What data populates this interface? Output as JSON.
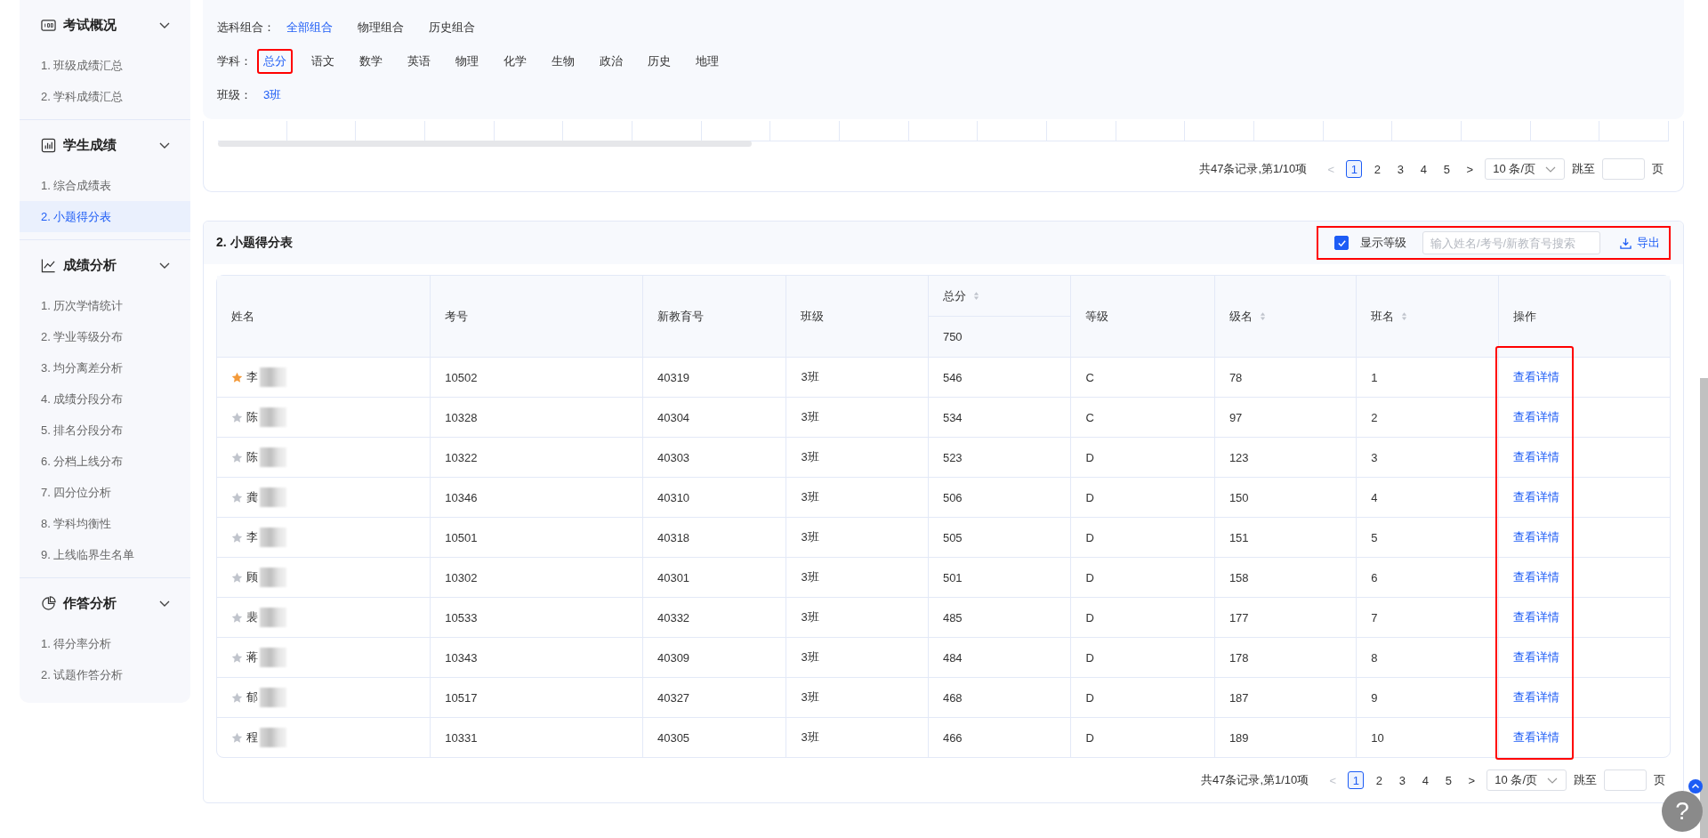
{
  "sidebar": {
    "sections": [
      {
        "title": "考试概况",
        "kind": "score",
        "expanded": true,
        "items": [
          {
            "label": "1. 班级成绩汇总",
            "selected": false
          },
          {
            "label": "2. 学科成绩汇总",
            "selected": false
          }
        ]
      },
      {
        "title": "学生成绩",
        "kind": "bars",
        "expanded": true,
        "items": [
          {
            "label": "1. 综合成绩表",
            "selected": false
          },
          {
            "label": "2. 小题得分表",
            "selected": true
          }
        ]
      },
      {
        "title": "成绩分析",
        "kind": "line",
        "expanded": true,
        "items": [
          {
            "label": "1. 历次学情统计",
            "selected": false
          },
          {
            "label": "2. 学业等级分布",
            "selected": false
          },
          {
            "label": "3. 均分离差分析",
            "selected": false
          },
          {
            "label": "4. 成绩分段分布",
            "selected": false
          },
          {
            "label": "5. 排名分段分布",
            "selected": false
          },
          {
            "label": "6. 分档上线分布",
            "selected": false
          },
          {
            "label": "7. 四分位分析",
            "selected": false
          },
          {
            "label": "8. 学科均衡性",
            "selected": false
          },
          {
            "label": "9. 上线临界生名单",
            "selected": false
          }
        ]
      },
      {
        "title": "作答分析",
        "kind": "pie",
        "expanded": true,
        "items": [
          {
            "label": "1. 得分率分析",
            "selected": false
          },
          {
            "label": "2. 试题作答分析",
            "selected": false
          }
        ]
      }
    ]
  },
  "filters": [
    {
      "label": "选科组合：",
      "options": [
        {
          "label": "全部组合",
          "selected": true,
          "highlighted": false
        },
        {
          "label": "物理组合",
          "selected": false,
          "highlighted": false
        },
        {
          "label": "历史组合",
          "selected": false,
          "highlighted": false
        }
      ]
    },
    {
      "label": "学科：",
      "options": [
        {
          "label": "总分",
          "selected": true,
          "highlighted": true
        },
        {
          "label": "语文",
          "selected": false,
          "highlighted": false
        },
        {
          "label": "数学",
          "selected": false,
          "highlighted": false
        },
        {
          "label": "英语",
          "selected": false,
          "highlighted": false
        },
        {
          "label": "物理",
          "selected": false,
          "highlighted": false
        },
        {
          "label": "化学",
          "selected": false,
          "highlighted": false
        },
        {
          "label": "生物",
          "selected": false,
          "highlighted": false
        },
        {
          "label": "政治",
          "selected": false,
          "highlighted": false
        },
        {
          "label": "历史",
          "selected": false,
          "highlighted": false
        },
        {
          "label": "地理",
          "selected": false,
          "highlighted": false
        }
      ]
    },
    {
      "label": "班级：",
      "options": [
        {
          "label": "3班",
          "selected": true,
          "highlighted": false
        }
      ]
    }
  ],
  "upper_pagination": {
    "summary": "共47条记录,第1/10项",
    "prev": {
      "label": "<",
      "disabled": true
    },
    "pages": [
      {
        "label": "1",
        "selected": true
      },
      {
        "label": "2",
        "selected": false
      },
      {
        "label": "3",
        "selected": false
      },
      {
        "label": "4",
        "selected": false
      },
      {
        "label": "5",
        "selected": false
      }
    ],
    "next": {
      "label": ">",
      "disabled": false
    },
    "page_size": "10 条/页",
    "jump_label": "跳至",
    "jump_suffix": "页"
  },
  "panel": {
    "title": "2. 小题得分表",
    "toolbar": {
      "highlighted": true,
      "show_grade": {
        "label": "显示等级",
        "checked": true
      },
      "search": {
        "placeholder": "输入姓名/考号/新教育号搜索"
      },
      "export": {
        "label": "导出"
      }
    },
    "table": {
      "columns": [
        {
          "label": "姓名",
          "sortable": false
        },
        {
          "label": "考号",
          "sortable": false
        },
        {
          "label": "新教育号",
          "sortable": false
        },
        {
          "label": "班级",
          "sortable": false
        },
        {
          "label": "总分",
          "sortable": true,
          "sub": "750"
        },
        {
          "label": "等级",
          "sortable": false
        },
        {
          "label": "级名",
          "sortable": true
        },
        {
          "label": "班名",
          "sortable": true
        },
        {
          "label": "操作",
          "sortable": false
        }
      ],
      "action_highlighted": true,
      "rows": [
        {
          "starred": true,
          "name": "李",
          "exam_no": "10502",
          "edu_no": "40319",
          "class": "3班",
          "total": "546",
          "grade": "C",
          "grade_rank": "78",
          "class_rank": "1",
          "action": "查看详情"
        },
        {
          "starred": false,
          "name": "陈",
          "exam_no": "10328",
          "edu_no": "40304",
          "class": "3班",
          "total": "534",
          "grade": "C",
          "grade_rank": "97",
          "class_rank": "2",
          "action": "查看详情"
        },
        {
          "starred": false,
          "name": "陈",
          "exam_no": "10322",
          "edu_no": "40303",
          "class": "3班",
          "total": "523",
          "grade": "D",
          "grade_rank": "123",
          "class_rank": "3",
          "action": "查看详情"
        },
        {
          "starred": false,
          "name": "龚",
          "exam_no": "10346",
          "edu_no": "40310",
          "class": "3班",
          "total": "506",
          "grade": "D",
          "grade_rank": "150",
          "class_rank": "4",
          "action": "查看详情"
        },
        {
          "starred": false,
          "name": "李",
          "exam_no": "10501",
          "edu_no": "40318",
          "class": "3班",
          "total": "505",
          "grade": "D",
          "grade_rank": "151",
          "class_rank": "5",
          "action": "查看详情"
        },
        {
          "starred": false,
          "name": "顾",
          "exam_no": "10302",
          "edu_no": "40301",
          "class": "3班",
          "total": "501",
          "grade": "D",
          "grade_rank": "158",
          "class_rank": "6",
          "action": "查看详情"
        },
        {
          "starred": false,
          "name": "裴",
          "exam_no": "10533",
          "edu_no": "40332",
          "class": "3班",
          "total": "485",
          "grade": "D",
          "grade_rank": "177",
          "class_rank": "7",
          "action": "查看详情"
        },
        {
          "starred": false,
          "name": "蒋",
          "exam_no": "10343",
          "edu_no": "40309",
          "class": "3班",
          "total": "484",
          "grade": "D",
          "grade_rank": "178",
          "class_rank": "8",
          "action": "查看详情"
        },
        {
          "starred": false,
          "name": "郁",
          "exam_no": "10517",
          "edu_no": "40327",
          "class": "3班",
          "total": "468",
          "grade": "D",
          "grade_rank": "187",
          "class_rank": "9",
          "action": "查看详情"
        },
        {
          "starred": false,
          "name": "程",
          "exam_no": "10331",
          "edu_no": "40305",
          "class": "3班",
          "total": "466",
          "grade": "D",
          "grade_rank": "189",
          "class_rank": "10",
          "action": "查看详情"
        }
      ]
    },
    "pagination": {
      "summary": "共47条记录,第1/10项",
      "prev": {
        "label": "<",
        "disabled": true
      },
      "pages": [
        {
          "label": "1",
          "selected": true
        },
        {
          "label": "2",
          "selected": false
        },
        {
          "label": "3",
          "selected": false
        },
        {
          "label": "4",
          "selected": false
        },
        {
          "label": "5",
          "selected": false
        }
      ],
      "next": {
        "label": ">",
        "disabled": false
      },
      "page_size": "10 条/页",
      "jump_label": "跳至",
      "jump_suffix": "页"
    }
  },
  "help": {
    "label": "?"
  }
}
